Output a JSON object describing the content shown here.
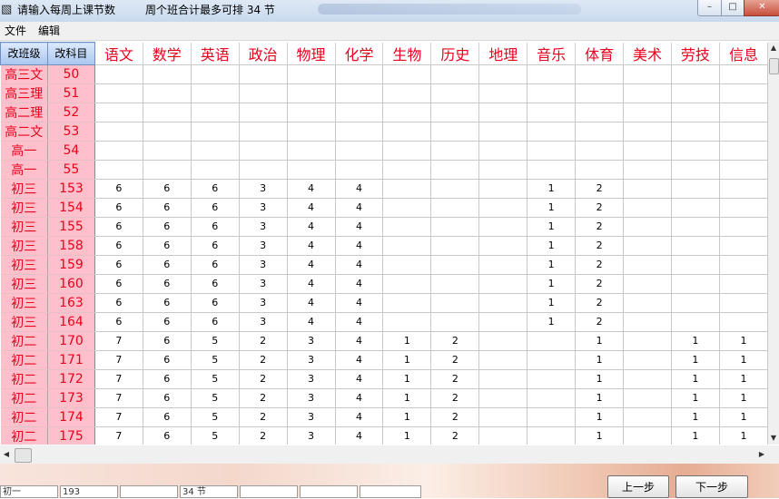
{
  "window": {
    "title": "请输入每周上课节数",
    "title_info": "周个班合计最多可排 34 节"
  },
  "menu": [
    "文件",
    "编辑"
  ],
  "grid": {
    "header_buttons": [
      "改班级",
      "改科目"
    ],
    "subjects": [
      "语文",
      "数学",
      "英语",
      "政治",
      "物理",
      "化学",
      "生物",
      "历史",
      "地理",
      "音乐",
      "体育",
      "美术",
      "劳技",
      "信息"
    ],
    "rows": [
      {
        "cls": "高三文",
        "num": "50",
        "values": [
          "",
          "",
          "",
          "",
          "",
          "",
          "",
          "",
          "",
          "",
          "",
          "",
          "",
          ""
        ]
      },
      {
        "cls": "高三理",
        "num": "51",
        "values": [
          "",
          "",
          "",
          "",
          "",
          "",
          "",
          "",
          "",
          "",
          "",
          "",
          "",
          ""
        ]
      },
      {
        "cls": "高二理",
        "num": "52",
        "values": [
          "",
          "",
          "",
          "",
          "",
          "",
          "",
          "",
          "",
          "",
          "",
          "",
          "",
          ""
        ]
      },
      {
        "cls": "高二文",
        "num": "53",
        "values": [
          "",
          "",
          "",
          "",
          "",
          "",
          "",
          "",
          "",
          "",
          "",
          "",
          "",
          ""
        ]
      },
      {
        "cls": "高一",
        "num": "54",
        "values": [
          "",
          "",
          "",
          "",
          "",
          "",
          "",
          "",
          "",
          "",
          "",
          "",
          "",
          ""
        ]
      },
      {
        "cls": "高一",
        "num": "55",
        "values": [
          "",
          "",
          "",
          "",
          "",
          "",
          "",
          "",
          "",
          "",
          "",
          "",
          "",
          ""
        ]
      },
      {
        "cls": "初三",
        "num": "153",
        "values": [
          "6",
          "6",
          "6",
          "3",
          "4",
          "4",
          "",
          "",
          "",
          "1",
          "2",
          "",
          "",
          ""
        ]
      },
      {
        "cls": "初三",
        "num": "154",
        "values": [
          "6",
          "6",
          "6",
          "3",
          "4",
          "4",
          "",
          "",
          "",
          "1",
          "2",
          "",
          "",
          ""
        ]
      },
      {
        "cls": "初三",
        "num": "155",
        "values": [
          "6",
          "6",
          "6",
          "3",
          "4",
          "4",
          "",
          "",
          "",
          "1",
          "2",
          "",
          "",
          ""
        ]
      },
      {
        "cls": "初三",
        "num": "158",
        "values": [
          "6",
          "6",
          "6",
          "3",
          "4",
          "4",
          "",
          "",
          "",
          "1",
          "2",
          "",
          "",
          ""
        ]
      },
      {
        "cls": "初三",
        "num": "159",
        "values": [
          "6",
          "6",
          "6",
          "3",
          "4",
          "4",
          "",
          "",
          "",
          "1",
          "2",
          "",
          "",
          ""
        ]
      },
      {
        "cls": "初三",
        "num": "160",
        "values": [
          "6",
          "6",
          "6",
          "3",
          "4",
          "4",
          "",
          "",
          "",
          "1",
          "2",
          "",
          "",
          ""
        ]
      },
      {
        "cls": "初三",
        "num": "163",
        "values": [
          "6",
          "6",
          "6",
          "3",
          "4",
          "4",
          "",
          "",
          "",
          "1",
          "2",
          "",
          "",
          ""
        ]
      },
      {
        "cls": "初三",
        "num": "164",
        "values": [
          "6",
          "6",
          "6",
          "3",
          "4",
          "4",
          "",
          "",
          "",
          "1",
          "2",
          "",
          "",
          ""
        ]
      },
      {
        "cls": "初二",
        "num": "170",
        "values": [
          "7",
          "6",
          "5",
          "2",
          "3",
          "4",
          "1",
          "2",
          "",
          "",
          "1",
          "",
          "1",
          "1"
        ]
      },
      {
        "cls": "初二",
        "num": "171",
        "values": [
          "7",
          "6",
          "5",
          "2",
          "3",
          "4",
          "1",
          "2",
          "",
          "",
          "1",
          "",
          "1",
          "1"
        ]
      },
      {
        "cls": "初二",
        "num": "172",
        "values": [
          "7",
          "6",
          "5",
          "2",
          "3",
          "4",
          "1",
          "2",
          "",
          "",
          "1",
          "",
          "1",
          "1"
        ]
      },
      {
        "cls": "初二",
        "num": "173",
        "values": [
          "7",
          "6",
          "5",
          "2",
          "3",
          "4",
          "1",
          "2",
          "",
          "",
          "1",
          "",
          "1",
          "1"
        ]
      },
      {
        "cls": "初二",
        "num": "174",
        "values": [
          "7",
          "6",
          "5",
          "2",
          "3",
          "4",
          "1",
          "2",
          "",
          "",
          "1",
          "",
          "1",
          "1"
        ]
      },
      {
        "cls": "初二",
        "num": "175",
        "values": [
          "7",
          "6",
          "5",
          "2",
          "3",
          "4",
          "1",
          "2",
          "",
          "",
          "1",
          "",
          "1",
          "1"
        ]
      }
    ]
  },
  "status": {
    "fields": [
      "初一",
      "193",
      "",
      "34 节",
      "",
      "",
      ""
    ]
  },
  "nav": {
    "prev": "上一步",
    "next": "下一步"
  },
  "colors": {
    "subject_text": "#e8001c",
    "class_cell_bg": "#ffc0cb",
    "header_button_bg": "#aac6ef"
  }
}
